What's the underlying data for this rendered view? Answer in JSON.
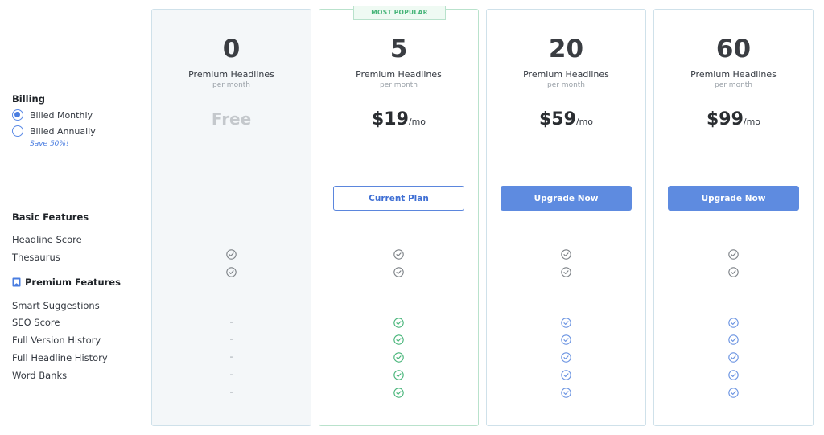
{
  "billing": {
    "title": "Billing",
    "options": [
      {
        "label": "Billed Monthly",
        "selected": true
      },
      {
        "label": "Billed Annually",
        "selected": false
      }
    ],
    "save_note": "Save 50%!"
  },
  "sections": {
    "basic_title": "Basic Features",
    "premium_title": "Premium Features",
    "premium_icon": "bookmark-icon"
  },
  "features": {
    "basic": [
      "Headline Score",
      "Thesaurus"
    ],
    "premium": [
      "Smart Suggestions",
      "SEO Score",
      "Full Version History",
      "Full Headline History",
      "Word Banks"
    ]
  },
  "plans": [
    {
      "count": "0",
      "unit": "Premium Headlines",
      "period": "per month",
      "price": "Free",
      "price_suffix": "",
      "button": "",
      "basic": [
        "check",
        "check"
      ],
      "premium": [
        "-",
        "-",
        "-",
        "-",
        "-"
      ]
    },
    {
      "count": "5",
      "unit": "Premium Headlines",
      "period": "per month",
      "badge": "MOST POPULAR",
      "price": "$19",
      "price_suffix": "/mo",
      "button": "Current Plan",
      "basic": [
        "check",
        "check"
      ],
      "premium": [
        "check",
        "check",
        "check",
        "check",
        "check"
      ]
    },
    {
      "count": "20",
      "unit": "Premium Headlines",
      "period": "per month",
      "price": "$59",
      "price_suffix": "/mo",
      "button": "Upgrade Now",
      "basic": [
        "check",
        "check"
      ],
      "premium": [
        "check",
        "check",
        "check",
        "check",
        "check"
      ]
    },
    {
      "count": "60",
      "unit": "Premium Headlines",
      "period": "per month",
      "price": "$99",
      "price_suffix": "/mo",
      "button": "Upgrade Now",
      "basic": [
        "check",
        "check"
      ],
      "premium": [
        "check",
        "check",
        "check",
        "check",
        "check"
      ]
    }
  ],
  "colors": {
    "accent": "#5e8be0",
    "popular_green": "#47b579",
    "check_gray": "#7d8287",
    "check_green": "#47b579",
    "check_blue": "#6b94e2"
  }
}
